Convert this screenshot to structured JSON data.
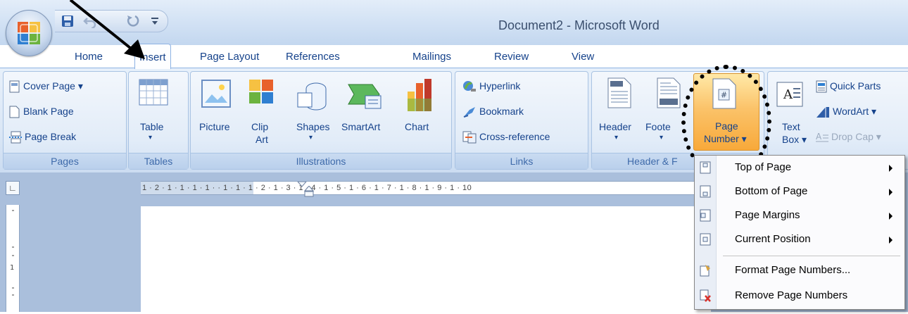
{
  "window": {
    "title": "Document2 - Microsoft Word"
  },
  "tabs": [
    "Home",
    "Insert",
    "Page Layout",
    "References",
    "Mailings",
    "Review",
    "View"
  ],
  "active_tab": "Insert",
  "groups": {
    "pages": {
      "label": "Pages",
      "cover_page": "Cover Page",
      "blank_page": "Blank Page",
      "page_break": "Page Break"
    },
    "tables": {
      "label": "Tables",
      "table": "Table"
    },
    "illustrations": {
      "label": "Illustrations",
      "picture": "Picture",
      "clip_art_1": "Clip",
      "clip_art_2": "Art",
      "shapes": "Shapes",
      "smartart": "SmartArt",
      "chart": "Chart"
    },
    "links": {
      "label": "Links",
      "hyperlink": "Hyperlink",
      "bookmark": "Bookmark",
      "cross_reference": "Cross-reference"
    },
    "header_footer": {
      "label": "Header & F",
      "header": "Header",
      "footer": "Foote",
      "page_number_1": "Page",
      "page_number_2": "Number"
    },
    "text": {
      "text_box_1": "Text",
      "text_box_2": "Box",
      "quick_parts": "Quick Parts",
      "wordart": "WordArt",
      "drop_cap": "Drop Cap"
    }
  },
  "ruler": {
    "marks": "1 · 2 · 1 · 1 · 1 · 1 ·   · 1 · 1 · 1 · 2 · 1 · 3 · 1 · 4 · 1 · 5 · 1 · 6 · 1 · 7 · 1 · 8 · 1 · 9 · 1 · 10"
  },
  "page_number_menu": {
    "items": [
      {
        "label": "Top of Page",
        "submenu": true,
        "icon": "page-top-icon"
      },
      {
        "label": "Bottom of Page",
        "submenu": true,
        "icon": "page-bottom-icon"
      },
      {
        "label": "Page Margins",
        "submenu": true,
        "icon": "page-margins-icon"
      },
      {
        "label": "Current Position",
        "submenu": true,
        "icon": "current-position-icon"
      },
      {
        "label": "Format Page Numbers...",
        "submenu": false,
        "icon": "format-page-numbers-icon"
      },
      {
        "label": "Remove Page Numbers",
        "submenu": false,
        "icon": "remove-page-numbers-icon"
      }
    ]
  },
  "colors": {
    "ribbon_text": "#15428b",
    "group_label": "#3e6aaa",
    "highlight_orange": "#f8a93a"
  }
}
